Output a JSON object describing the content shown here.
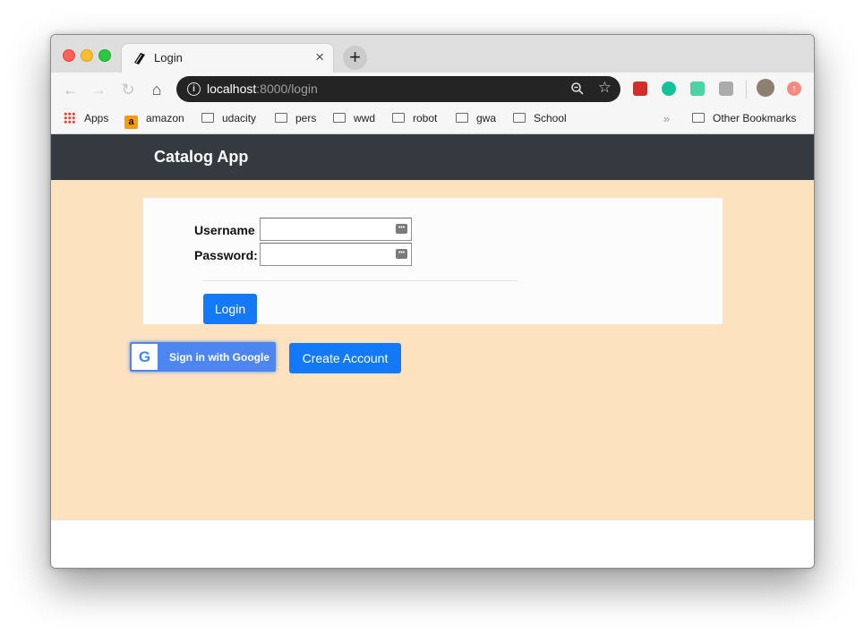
{
  "browser": {
    "tab_title": "Login",
    "tab_close": "×",
    "new_tab": "+",
    "url_host": "localhost",
    "url_rest": ":8000/login",
    "bookmarks": {
      "apps": "Apps",
      "amazon": "amazon",
      "udacity": "udacity",
      "pers": "pers",
      "wwd": "wwd",
      "robot": "robot",
      "gwa": "gwa",
      "school": "School",
      "overflow": "»",
      "other": "Other Bookmarks"
    }
  },
  "page": {
    "brand": "Catalog App",
    "username_label": "Username",
    "password_label": "Password:",
    "username_value": "",
    "password_value": "",
    "login_button": "Login",
    "google_button": "Sign in with Google",
    "google_logo": "G",
    "create_account_button": "Create Account"
  },
  "colors": {
    "navbar": "#343a40",
    "content_bg": "#fde2c0",
    "primary": "#1479f6",
    "google_blue": "#4e86f1"
  }
}
